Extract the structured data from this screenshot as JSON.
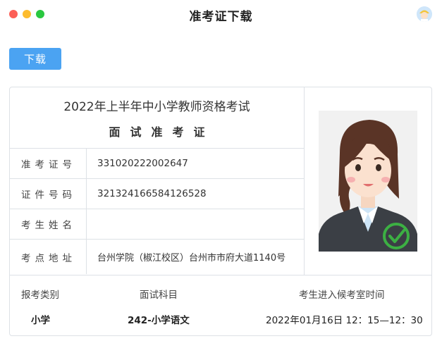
{
  "window": {
    "title": "准考证下载"
  },
  "toolbar": {
    "download_label": "下载"
  },
  "card": {
    "exam_title": "2022年上半年中小学教师资格考试",
    "admit_title": "面试准考证",
    "rows": [
      {
        "label": "准考证号",
        "value": "331020222002647"
      },
      {
        "label": "证件号码",
        "value": "321324166584126528"
      },
      {
        "label": "考生姓名",
        "value": ""
      },
      {
        "label": "考点地址",
        "value": "台州学院（椒江校区）台州市市府大道1140号"
      }
    ],
    "photo_icon": "female-avatar-with-checkmark-icon",
    "bottom": {
      "headers": [
        "报考类别",
        "面试科目",
        "考生进入候考室时间"
      ],
      "values": [
        "小学",
        "242-小学语文",
        "2022年01月16日 12：15—12：30"
      ]
    }
  },
  "colors": {
    "accent": "#4ba3f2",
    "border": "#dde1e6",
    "check_green": "#3cb043"
  }
}
